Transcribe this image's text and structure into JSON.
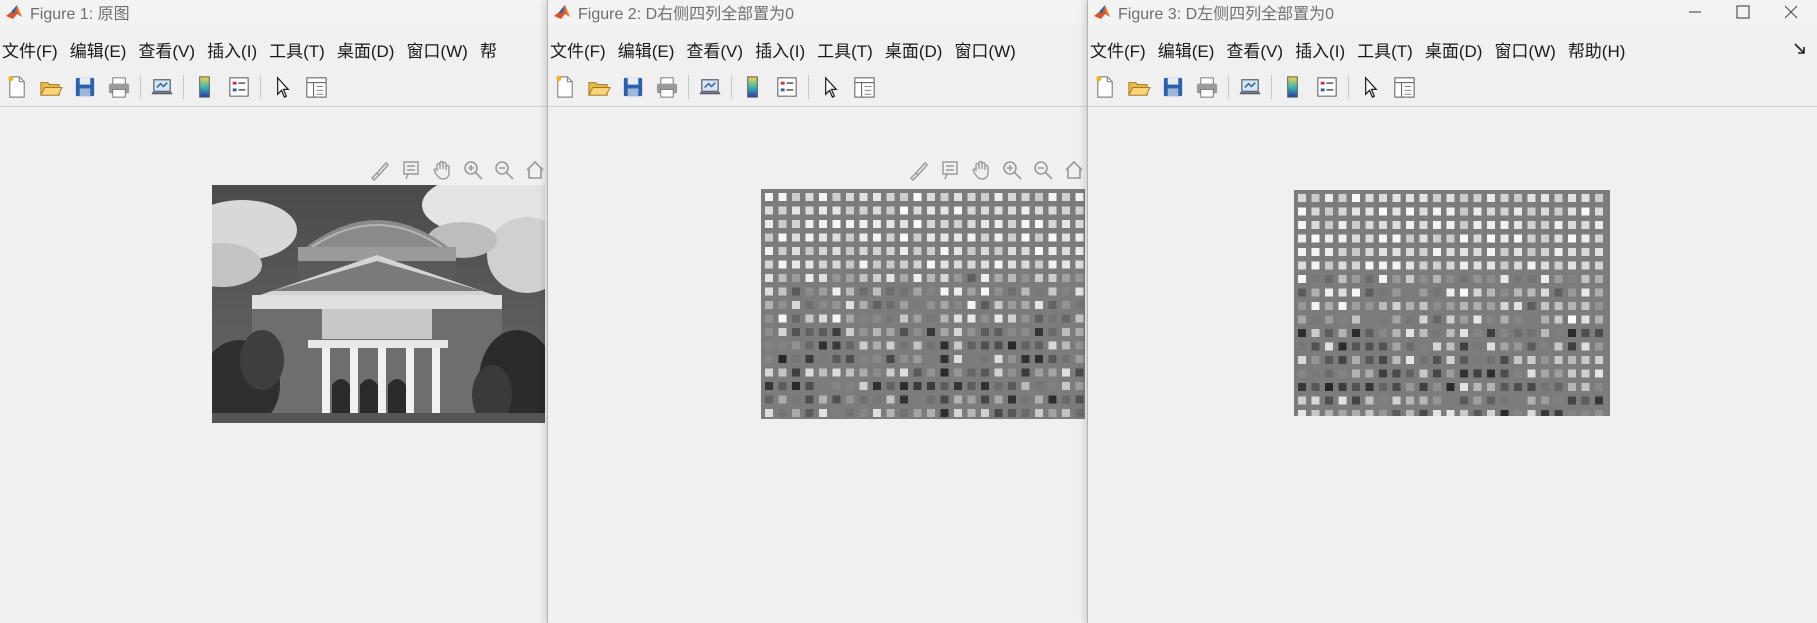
{
  "figures": [
    {
      "title": "Figure 1: 原图",
      "menus": [
        "文件(F)",
        "编辑(E)",
        "查看(V)",
        "插入(I)",
        "工具(T)",
        "桌面(D)",
        "窗口(W)",
        "帮"
      ],
      "image": "grayscale photo of domed building"
    },
    {
      "title": "Figure 2: D右侧四列全部置为0",
      "menus": [
        "文件(F)",
        "编辑(E)",
        "查看(V)",
        "插入(I)",
        "工具(T)",
        "桌面(D)",
        "窗口(W)"
      ],
      "image": "block-compressed image (right four DCT columns zeroed)"
    },
    {
      "title": "Figure 3: D左侧四列全部置为0",
      "menus": [
        "文件(F)",
        "编辑(E)",
        "查看(V)",
        "插入(I)",
        "工具(T)",
        "桌面(D)",
        "窗口(W)",
        "帮助(H)"
      ],
      "image": "block-compressed image (left four DCT columns zeroed)"
    }
  ],
  "toolbar_icons": [
    "new-figure-icon",
    "open-file-icon",
    "save-icon",
    "print-icon",
    "link-plot-icon",
    "colorbar-icon",
    "legend-icon",
    "edit-plot-arrow-icon",
    "property-inspector-icon"
  ],
  "axes_toolbar_icons": [
    "brush-icon",
    "data-tips-icon",
    "pan-hand-icon",
    "zoom-in-icon",
    "zoom-out-icon",
    "home-restore-icon"
  ],
  "window_controls": [
    "minimize-icon",
    "maximize-icon",
    "close-icon"
  ],
  "colors": {
    "matlab_logo": "#d9532b",
    "background": "#f0f0f0",
    "title_text": "#6f6f6f"
  }
}
